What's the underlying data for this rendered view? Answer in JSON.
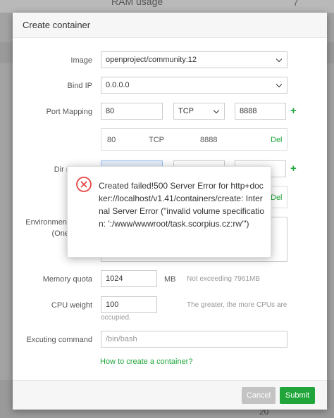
{
  "background": {
    "ram_label": "RAM usage",
    "ram_value": "7",
    "footer_number": "20"
  },
  "modal": {
    "title": "Create container",
    "form": {
      "image": {
        "label": "Image",
        "value": "openproject/community:12"
      },
      "bind_ip": {
        "label": "Bind IP",
        "value": "0.0.0.0"
      },
      "port_mapping": {
        "label": "Port Mapping",
        "container_port": "80",
        "protocol": "TCP",
        "host_port": "8888",
        "entries": [
          {
            "port": "80",
            "protocol": "TCP",
            "host": "8888",
            "action": "Del"
          }
        ]
      },
      "dir_mapping": {
        "label": "Dir m",
        "entries": [
          {
            "action": "Del"
          }
        ]
      },
      "environment": {
        "label": "Environment",
        "sublabel": "(One"
      },
      "memory_quota": {
        "label": "Memory quota",
        "value": "1024",
        "unit": "MB",
        "hint": "Not exceeding 7961MB"
      },
      "cpu_weight": {
        "label": "CPU weight",
        "value": "100",
        "hint_line1": "The greater, the more CPUs are",
        "hint_line2": "occupied."
      },
      "command": {
        "label": "Excuting command",
        "placeholder": "/bin/bash"
      },
      "help_link": "How to create a container?"
    },
    "footer": {
      "cancel_label": "Cancel",
      "submit_label": "Submit"
    }
  },
  "error_popup": {
    "message": "Created failed!500 Server Error for http+docker://localhost/v1.41/containers/create: Internal Server Error (\"invalid volume specification: ':/www/wwwroot/task.scorpius.cz:rw'\")"
  },
  "colors": {
    "accent": "#20a53a",
    "error": "#e64545",
    "cancel": "#c3c3c3"
  }
}
